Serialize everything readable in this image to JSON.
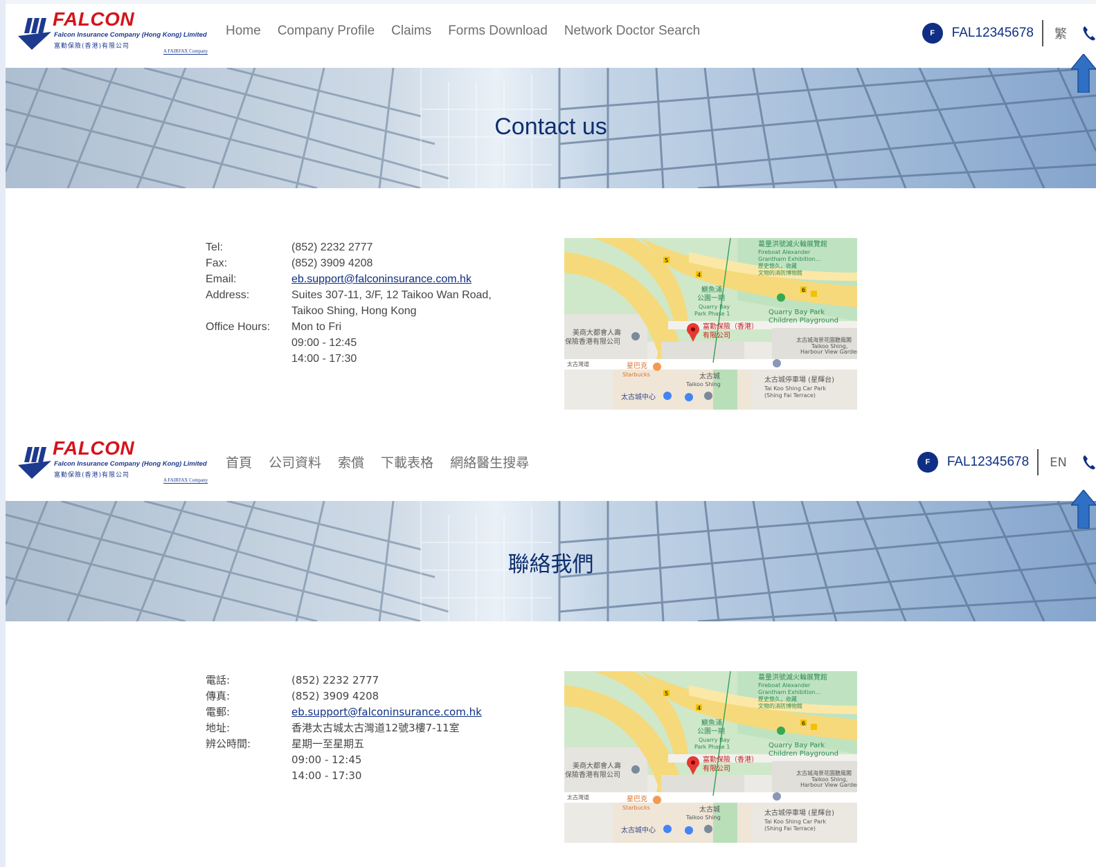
{
  "logo": {
    "word": "FALCON",
    "subtitle": "Falcon Insurance Company (Hong Kong) Limited",
    "zh_name": "富勤保險(香港)有限公司",
    "parent": "A FAIRFAX Company"
  },
  "en": {
    "nav": [
      "Home",
      "Company Profile",
      "Claims",
      "Forms Download",
      "Network Doctor Search"
    ],
    "avatar_letter": "F",
    "user_id": "FAL12345678",
    "lang_toggle": "繁",
    "banner_title": "Contact us",
    "labels": {
      "tel": "Tel:",
      "fax": "Fax:",
      "email": "Email:",
      "address": "Address:",
      "hours": "Office Hours:"
    },
    "values": {
      "tel": "(852) 2232 2777",
      "fax": "(852) 3909 4208",
      "email": "eb.support@falconinsurance.com.hk",
      "address_line1": "Suites 307-11, 3/F, 12 Taikoo Wan Road,",
      "address_line2": "Taikoo Shing, Hong Kong",
      "hours_days": "Mon to Fri",
      "hours_am": "09:00 - 12:45",
      "hours_pm": "14:00 - 17:30"
    }
  },
  "zh": {
    "nav": [
      "首頁",
      "公司資料",
      "索償",
      "下載表格",
      "網絡醫生搜尋"
    ],
    "avatar_letter": "F",
    "user_id": "FAL12345678",
    "lang_toggle": "EN",
    "banner_title": "聯絡我們",
    "labels": {
      "tel": "電話:",
      "fax": "傳真:",
      "email": "電郵:",
      "address": "地址:",
      "hours": "辨公時間:"
    },
    "values": {
      "tel": "(852) 2232 2777",
      "fax": "(852) 3909 4208",
      "email": "eb.support@falconinsurance.com.hk",
      "address": "香港太古城太古灣道12號3樓7-11室",
      "hours_days": "星期一至星期五",
      "hours_am": "09:00 - 12:45",
      "hours_pm": "14:00 - 17:30"
    }
  },
  "map": {
    "museum_zh": "葛量洪號滅火輪展覽館",
    "museum_en1": "Fireboat Alexander",
    "museum_en2": "Grantham Exhibition...",
    "museum_zh2": "歷史悠久，收藏",
    "museum_zh3": "文物的消防博物館",
    "park_zh1": "鰂魚涌",
    "park_zh2": "公園一期",
    "park_en1": "Quarry Bay",
    "park_en2": "Park Phase 1",
    "playground1": "Quarry Bay Park",
    "playground2": "Children Playground",
    "pin_zh1": "富勤保險（香港）",
    "pin_zh2": "有限公司",
    "aia_zh1": "美商大都會人壽",
    "aia_zh2": "保險香港有限公司",
    "harbour_zh": "太古城海景花園聽風閣",
    "harbour_en1": "Taikoo Shing,",
    "harbour_en2": "Harbour View Gardens...",
    "road_zh": "太古灣道",
    "starbucks_zh": "星巴克",
    "starbucks_en": "Starbucks",
    "taikoo_zh": "太古城",
    "taikoo_en": "Taikoo Shing",
    "carpark_zh": "太古城停車場 (星輝台)",
    "carpark_en1": "Tai Koo Shing Car Park",
    "carpark_en2": "(Shing Fai Terrace)",
    "centre_zh": "太古城中心",
    "road_num_5": "5",
    "road_num_4": "4",
    "road_num_6": "6"
  },
  "colors": {
    "brand_navy": "#0e2f83",
    "logo_red": "#d4141b",
    "nav_gray": "#6f6f6f",
    "scroll_arrow": "#2f6fc4"
  }
}
